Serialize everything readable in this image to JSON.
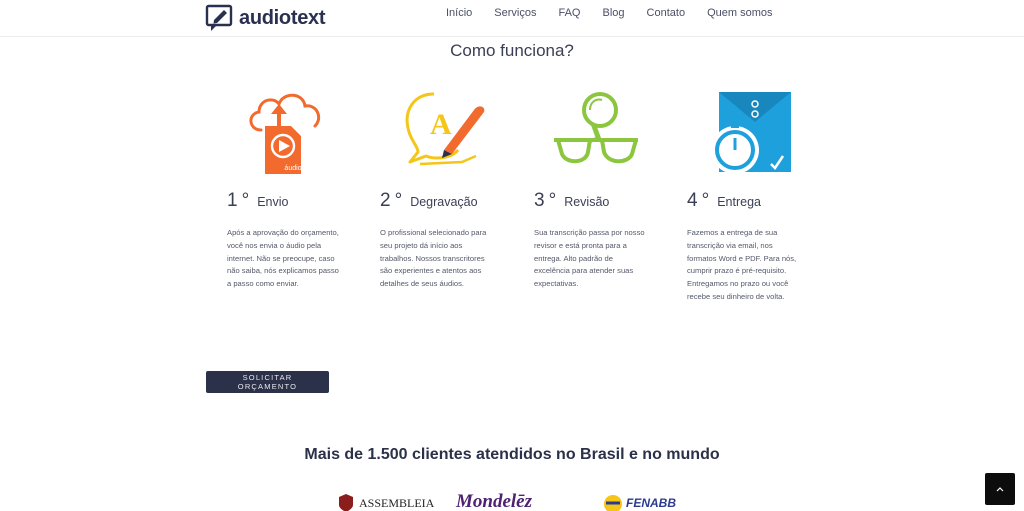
{
  "brand": {
    "name": "audiotext"
  },
  "nav": [
    "Início",
    "Serviços",
    "FAQ",
    "Blog",
    "Contato",
    "Quem somos"
  ],
  "section_title": "Como funciona?",
  "steps": [
    {
      "number": "1",
      "degree": "°",
      "title": "Envio",
      "icon": "cloud-upload-audio-icon",
      "color": "#f26a2e",
      "badge": "áudio",
      "description": "Após a aprovação do orçamento, você nos envia o áudio pela internet. Não se preocupe, caso não saiba, nós explicamos passo a passo como enviar."
    },
    {
      "number": "2",
      "degree": "°",
      "title": "Degravação",
      "icon": "quill-writing-icon",
      "color": "#f5c518",
      "description": "O profissional selecionado para seu projeto dá início aos trabalhos. Nossos transcritores são experientes e atentos aos detalhes de seus áudios."
    },
    {
      "number": "3",
      "degree": "°",
      "title": "Revisão",
      "icon": "magnifier-glasses-icon",
      "color": "#8cc63f",
      "description": "Sua transcrição passa por nosso revisor e está pronta para a entrega. Alto padrão de excelência para atender suas expectativas."
    },
    {
      "number": "4",
      "degree": "°",
      "title": "Entrega",
      "icon": "envelope-stopwatch-icon",
      "color": "#1ea0dc",
      "description": "Fazemos a entrega de sua transcrição via email, nos formatos Word e PDF. Para nós, cumprir prazo é pré-requisito. Entregamos no prazo ou você recebe seu dinheiro de volta."
    }
  ],
  "cta_label": "SOLICITAR ORÇAMENTO",
  "clients_title": "Mais de 1.500 clientes atendidos no Brasil e no mundo",
  "client_logos": [
    "ASSEMBLEIA",
    "Mondelēz",
    "FENABB"
  ],
  "colors": {
    "navy": "#2b3149",
    "orange": "#f26a2e",
    "yellow": "#f5c518",
    "green": "#8cc63f",
    "blue": "#1ea0dc",
    "mondelez_purple": "#4f2170"
  }
}
